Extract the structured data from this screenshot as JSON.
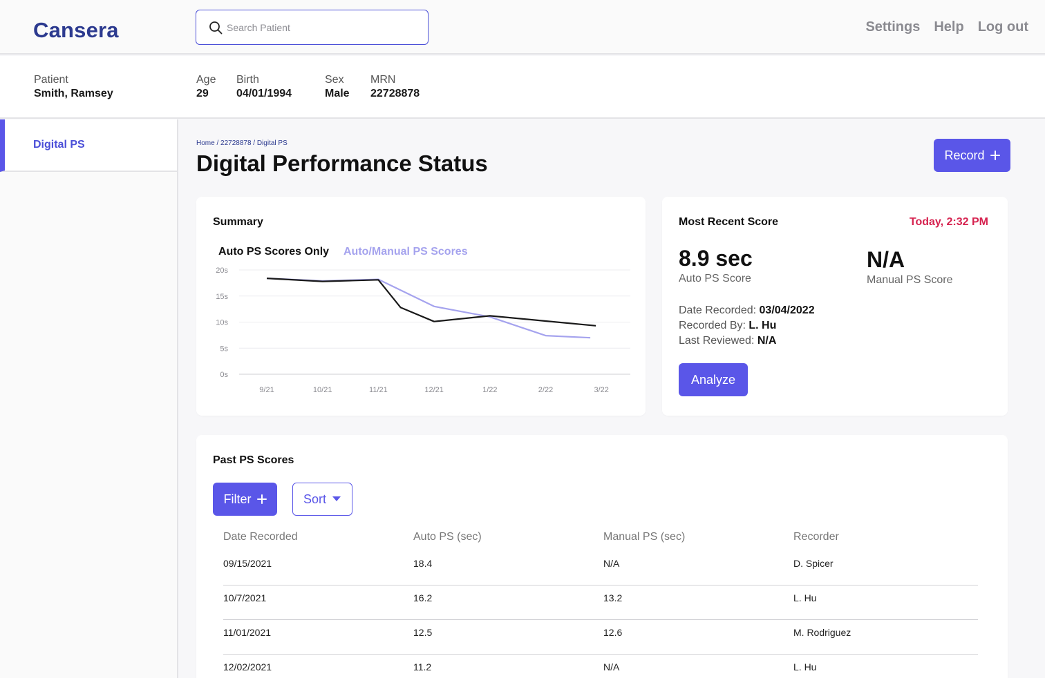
{
  "app": {
    "logo": "Cansera"
  },
  "search": {
    "placeholder": "Search Patient"
  },
  "topnav": {
    "settings": "Settings",
    "help": "Help",
    "logout": "Log out"
  },
  "patient": {
    "patient_label": "Patient",
    "patient_name": "Smith, Ramsey",
    "age_label": "Age",
    "age": "29",
    "birth_label": "Birth",
    "birth": "04/01/1994",
    "sex_label": "Sex",
    "sex": "Male",
    "mrn_label": "MRN",
    "mrn": "22728878"
  },
  "sidebar": {
    "items": [
      {
        "label": "Digital PS",
        "active": true
      }
    ]
  },
  "main": {
    "breadcrumb": "Home / 22728878 / Digital PS",
    "title": "Digital Performance Status",
    "record_button": "Record"
  },
  "summary": {
    "title": "Summary",
    "tab_auto": "Auto PS Scores Only",
    "tab_both": "Auto/Manual PS Scores"
  },
  "chart_data": {
    "type": "line",
    "x": [
      "9/21",
      "10/21",
      "11/21",
      "12/21",
      "1/22",
      "2/22",
      "3/22"
    ],
    "y_ticks": [
      "20s",
      "15s",
      "10s",
      "5s",
      "0s"
    ],
    "ylim": [
      0,
      20
    ],
    "grid": true,
    "series": [
      {
        "color": "#1a1a1a",
        "points": [
          [
            0,
            18.4
          ],
          [
            1,
            17.8
          ],
          [
            2,
            18.1
          ],
          [
            2.4,
            12.8
          ],
          [
            3,
            10.1
          ],
          [
            4,
            11.2
          ],
          [
            5,
            10.2
          ],
          [
            5.9,
            9.3
          ]
        ]
      },
      {
        "color": "#a5a3ee",
        "points": [
          [
            0,
            18.4
          ],
          [
            1,
            17.9
          ],
          [
            2,
            18.2
          ],
          [
            3,
            13.0
          ],
          [
            4,
            11.0
          ],
          [
            5,
            7.4
          ],
          [
            5.8,
            7.0
          ]
        ]
      }
    ]
  },
  "recent": {
    "title": "Most Recent Score",
    "timestamp": "Today, 2:32 PM",
    "auto_value": "8.9 sec",
    "auto_label": "Auto PS Score",
    "manual_value": "N/A",
    "manual_label": "Manual PS Score",
    "date_label": "Date Recorded:",
    "date_value": "03/04/2022",
    "recorder_label": "Recorded By:",
    "recorder_value": "L. Hu",
    "reviewed_label": "Last Reviewed:",
    "reviewed_value": "N/A",
    "analyze_button": "Analyze"
  },
  "past": {
    "title": "Past PS Scores",
    "filter_button": "Filter",
    "sort_button": "Sort",
    "columns": [
      "Date Recorded",
      "Auto PS (sec)",
      "Manual PS (sec)",
      "Recorder"
    ],
    "rows": [
      [
        "09/15/2021",
        "18.4",
        "N/A",
        "D. Spicer"
      ],
      [
        "10/7/2021",
        "16.2",
        "13.2",
        "L. Hu"
      ],
      [
        "11/01/2021",
        "12.5",
        "12.6",
        "M. Rodriguez"
      ],
      [
        "12/02/2021",
        "11.2",
        "N/A",
        "L. Hu"
      ]
    ]
  },
  "colors": {
    "accent": "#5a56e8",
    "brand": "#2c3a8f",
    "timestamp": "#d6224f",
    "series_secondary": "#a5a3ee"
  },
  "icons": {
    "search": "search-icon",
    "plus": "plus-icon",
    "caret": "caret-down-icon"
  }
}
